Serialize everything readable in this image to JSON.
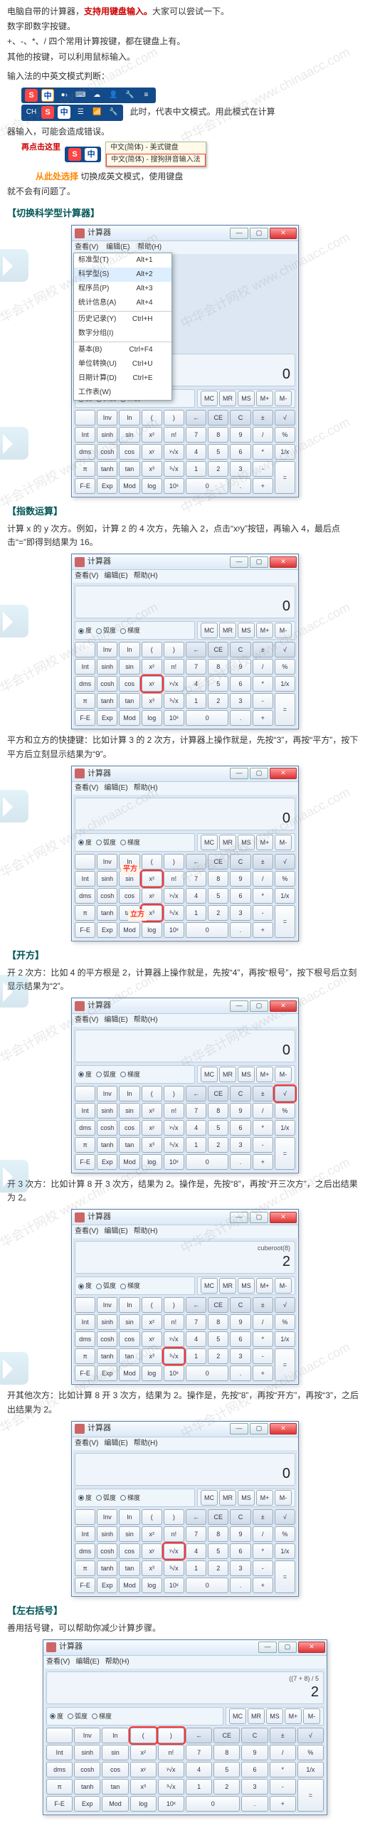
{
  "watermark": "中华会计网校 www.chinaacc.com",
  "intro": {
    "p1a": "电脑自带的计算器，",
    "p1b": "支持用键盘输入。",
    "p1c": "大家可以尝试一下。",
    "p2": "数字即数字按键。",
    "p3": "+、-、*、/ 四个常用计算按键，都在键盘上有。",
    "p4": "其他的按键，可以利用鼠标输入。",
    "p5": "输入法的中英文模式判断：",
    "p6a": "此时，代表中文模式。用此模式在计算",
    "p6b": "器输入，可能会造成错误。",
    "p7a": "再点击这里",
    "p7b": "从此处选择",
    "p7c": "切换成英文模式，使用键盘",
    "p7d": "就不会有问题了。"
  },
  "ime": {
    "s": "S",
    "cn": "中",
    "ch": "CH",
    "opt1": "中文(简体) - 美式键盘",
    "opt2": "中文(简体) - 搜狗拼音输入法"
  },
  "sect1": {
    "title": "【切换科学型计算器】",
    "calc_title": "计算器",
    "menu": {
      "v": "查看(V)",
      "e": "编辑(E)",
      "h": "帮助(H)"
    },
    "dd": [
      [
        "标准型(T)",
        "Alt+1"
      ],
      [
        "科学型(S)",
        "Alt+2"
      ],
      [
        "程序员(P)",
        "Alt+3"
      ],
      [
        "统计信息(A)",
        "Alt+4"
      ],
      [
        "历史记录(Y)",
        "Ctrl+H"
      ],
      [
        "数字分组(I)",
        ""
      ],
      [
        "基本(B)",
        "Ctrl+F4"
      ],
      [
        "单位转换(U)",
        "Ctrl+U"
      ],
      [
        "日期计算(D)",
        "Ctrl+E"
      ],
      [
        "工作表(W)",
        ""
      ]
    ],
    "disp": "0",
    "radios": {
      "deg": "度",
      "rad": "弧度",
      "grad": "梯度"
    },
    "mem": [
      "MC",
      "MR",
      "MS",
      "M+",
      "M-"
    ],
    "row_sm": [
      "",
      "Inv",
      "ln",
      "(",
      ")"
    ],
    "grid": [
      [
        "Int",
        "sinh",
        "sin",
        "x²",
        "n!",
        "7",
        "8",
        "9",
        "/",
        "%"
      ],
      [
        "dms",
        "cosh",
        "cos",
        "xʸ",
        "ʸ√x",
        "4",
        "5",
        "6",
        "*",
        "1/x"
      ],
      [
        "π",
        "tanh",
        "tan",
        "x³",
        "³√x",
        "1",
        "2",
        "3",
        "-",
        "="
      ],
      [
        "F-E",
        "Exp",
        "Mod",
        "log",
        "10ˣ",
        "0",
        "",
        ".",
        "+",
        ""
      ]
    ],
    "clear": [
      "←",
      "CE",
      "C",
      "±",
      "√"
    ]
  },
  "sect2": {
    "title": "【指数运算】",
    "p1": "计算 x 的 y 次方。例如，计算 2 的 4 次方，先输入 2，点击“xʸy”按钮，再输入 4，最后点击“=”即得到结果为 16。",
    "p2": "平方和立方的快捷键：比如计算 3 的 2 次方，计算器上操作就是，先按“3”，再按“平方”，按下平方后立刻显示结果为“9”。",
    "annot_sq": "平方",
    "annot_cb": "立方"
  },
  "sect3": {
    "title": "【开方】",
    "p1": "开 2 次方：比如 4 的平方根是 2，计算器上操作就是，先按“4”，再按“根号”，按下根号后立刻显示结果为“2”。",
    "p2": "开 3 次方：比如计算 8 开 3 次方，结果为 2。操作是，先按“8”，再按“开三次方”，之后出结果为 2。",
    "p3": "开其他次方：比如计算 8 开 3 次方，结果为 2。操作是，先按“8”，再按“开方”，再按“3”，之后出结果为 2。",
    "cuberoot": "cuberoot(8)",
    "disp2": "2"
  },
  "sect4": {
    "title": "【左右括号】",
    "p1": "善用括号键，可以帮助你减少计算步骤。",
    "expr": "((7 + 8) / 5",
    "disp": "2"
  }
}
